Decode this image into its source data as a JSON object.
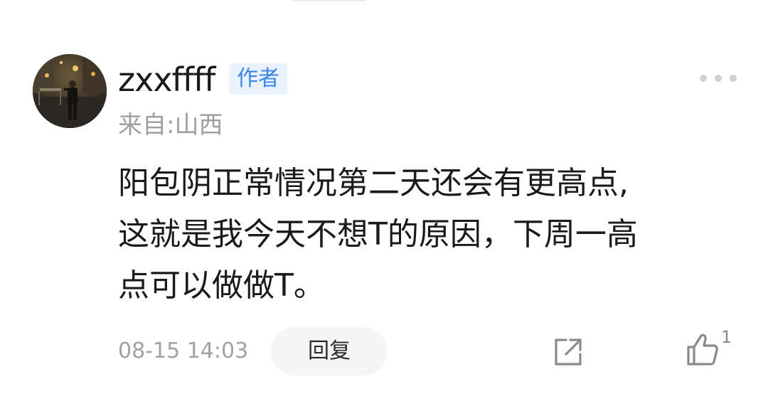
{
  "comment": {
    "avatar_icon": "user-avatar-photo",
    "username": "zxxffff",
    "author_badge": "作者",
    "location": "来自:山西",
    "more_icon": "more-dots-icon",
    "content_lines": [
      "阳包阴正常情况第二天还会有更高点,",
      "这就是我今天不想T的原因，下周一高",
      "点可以做做T。"
    ],
    "timestamp": "08-15 14:03",
    "reply_label": "回复",
    "share_icon": "share-external-icon",
    "like_icon": "thumbs-up-icon",
    "like_count": "1"
  },
  "colors": {
    "badge_bg": "#e9f2fd",
    "badge_text": "#3a86e8",
    "secondary_text": "#9e9e9e",
    "primary_text": "#1a1a1a",
    "reply_bg": "#f5f5f5"
  }
}
